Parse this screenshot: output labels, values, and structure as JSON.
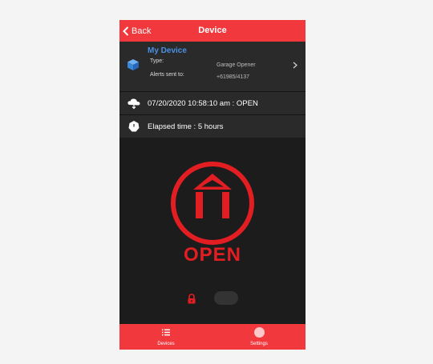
{
  "header": {
    "back_label": "Back",
    "title": "Device"
  },
  "device": {
    "name": "My Device",
    "type_label": "Type:",
    "type_value": "Garage Opener",
    "alerts_label": "Alerts sent to:",
    "alerts_value": "+61985/4137"
  },
  "status": {
    "text": "07/20/2020 10:58:10 am : OPEN"
  },
  "elapsed": {
    "text": "Elapsed time : 5 hours"
  },
  "main": {
    "state_label": "OPEN",
    "toggle_on": false
  },
  "tabs": [
    {
      "label": "Devices",
      "icon": "list-icon"
    },
    {
      "label": "Settings",
      "icon": "settings-icon"
    }
  ],
  "colors": {
    "accent": "#f0383d",
    "state_red": "#e21e22",
    "device_name": "#4a90e2",
    "background": "#1c1c1c"
  }
}
